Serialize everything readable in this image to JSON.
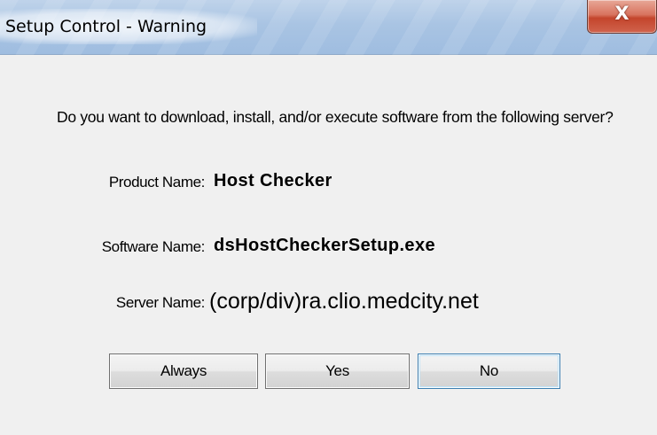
{
  "window": {
    "title": "Setup Control - Warning",
    "close_icon": "close-icon",
    "close_glyph": "X"
  },
  "dialog": {
    "prompt": "Do you want to download, install, and/or execute software from the following server?",
    "fields": [
      {
        "label": "Product Name:",
        "value": "Host Checker"
      },
      {
        "label": "Software Name:",
        "value": "dsHostCheckerSetup.exe"
      },
      {
        "label": "Server Name:",
        "value": "(corp/div)ra.clio.medcity.net"
      }
    ]
  },
  "buttons": {
    "always_label": "Always",
    "yes_label": "Yes",
    "no_label": "No",
    "default_button": "No"
  },
  "colors": {
    "titlebar": "#a9c4e3",
    "close_button": "#c4452c",
    "dialog_background": "#f0f0f0",
    "default_button_border": "#3c7fb1"
  }
}
